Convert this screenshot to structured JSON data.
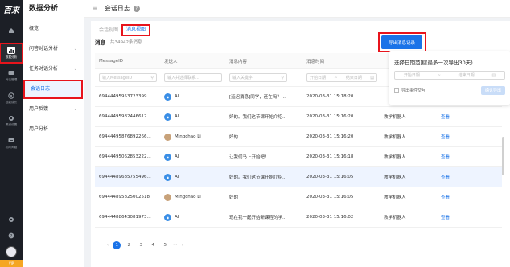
{
  "rail": {
    "logo": "百来",
    "items": [
      {
        "label": "",
        "icon": "home-icon"
      },
      {
        "label": "数据分析",
        "icon": "chart-icon",
        "active": true
      },
      {
        "label": "对话管理",
        "icon": "chat-icon"
      },
      {
        "label": "技能成长",
        "icon": "growth-icon"
      },
      {
        "label": "渠道设置",
        "icon": "settings-icon"
      },
      {
        "label": "机时间题",
        "icon": "message-icon"
      }
    ],
    "bottom_gear": "gear-icon",
    "bottom_help": "help-icon",
    "vip_label": "VIP"
  },
  "sidebar": {
    "title": "数据分析",
    "items": [
      {
        "label": "概览",
        "has_children": false
      },
      {
        "label": "问答对话分析",
        "has_children": true
      },
      {
        "label": "任务对话分析",
        "has_children": true
      },
      {
        "label": "会话日志",
        "has_children": false,
        "active": true
      },
      {
        "label": "用户反馈",
        "has_children": true
      },
      {
        "label": "用户分析",
        "has_children": false
      }
    ]
  },
  "header": {
    "title": "会话日志",
    "help": "?"
  },
  "tabs": [
    {
      "label": "会话视图",
      "active": false
    },
    {
      "label": "消息视图",
      "active": true
    }
  ],
  "subhead": {
    "title": "消息",
    "count": "共34942条消息"
  },
  "table": {
    "columns": [
      "MessageID",
      "发送人",
      "消息内容",
      "消息时间",
      "",
      ""
    ],
    "filters": {
      "id_placeholder": "输入MessageID",
      "sender_placeholder": "输入并选择联系...",
      "content_placeholder": "输入关键字",
      "date_start": "开始日期",
      "date_sep": "~",
      "date_end": "结束日期"
    },
    "rows": [
      {
        "id": "69444495953723399...",
        "sender": "AI",
        "avatar": "ai",
        "content": "[延迟消息]同学，还在吗？...",
        "time": "2020-03-31 15:18:20",
        "bot": "",
        "action": ""
      },
      {
        "id": "6944449598244661​2",
        "sender": "AI",
        "avatar": "ai",
        "content": "好的。我们这节课开始介绍...",
        "time": "2020-03-31 15:16:20",
        "bot": "教学机器人",
        "action": "查看"
      },
      {
        "id": "69444495876892266...",
        "sender": "Mingchao Li",
        "avatar": "photo",
        "content": "好的",
        "time": "2020-03-31 15:16:20",
        "bot": "教学机器人",
        "action": "查看"
      },
      {
        "id": "69444495062853222...",
        "sender": "AI",
        "avatar": "ai",
        "content": "让我们马上开始吧！",
        "time": "2020-03-31 15:16:18",
        "bot": "教学机器人",
        "action": "查看"
      },
      {
        "id": "69444489685755496...",
        "sender": "AI",
        "avatar": "ai",
        "content": "好的。我们这节课开始介绍...",
        "time": "2020-03-31 15:16:05",
        "bot": "教学机器人",
        "action": "查看",
        "hover": true
      },
      {
        "id": "6944448958250025​18",
        "sender": "Mingchao Li",
        "avatar": "photo",
        "content": "好的",
        "time": "2020-03-31 15:16:05",
        "bot": "教学机器人",
        "action": "查看"
      },
      {
        "id": "69444488643081973...",
        "sender": "AI",
        "avatar": "ai",
        "content": "现在我一起开始新课程的学...",
        "time": "2020-03-31 15:16:02",
        "bot": "教学机器人",
        "action": "查看"
      }
    ]
  },
  "pager": {
    "pages": [
      "1",
      "2",
      "3",
      "4",
      "5"
    ],
    "current": "1",
    "prev": "‹",
    "next": "›",
    "ellipsis": "···"
  },
  "export": {
    "button_label": "导出消息记录",
    "popover_title": "选择日期范围(最多一次导出30天)",
    "start_placeholder": "开始日期",
    "sep": "~",
    "end_placeholder": "结束日期",
    "checkbox_label": "导出事件交互",
    "confirm_label": "确认导出"
  },
  "colors": {
    "accent": "#1a73e8",
    "highlight": "#e8141c",
    "rail": "#1c1f26"
  }
}
